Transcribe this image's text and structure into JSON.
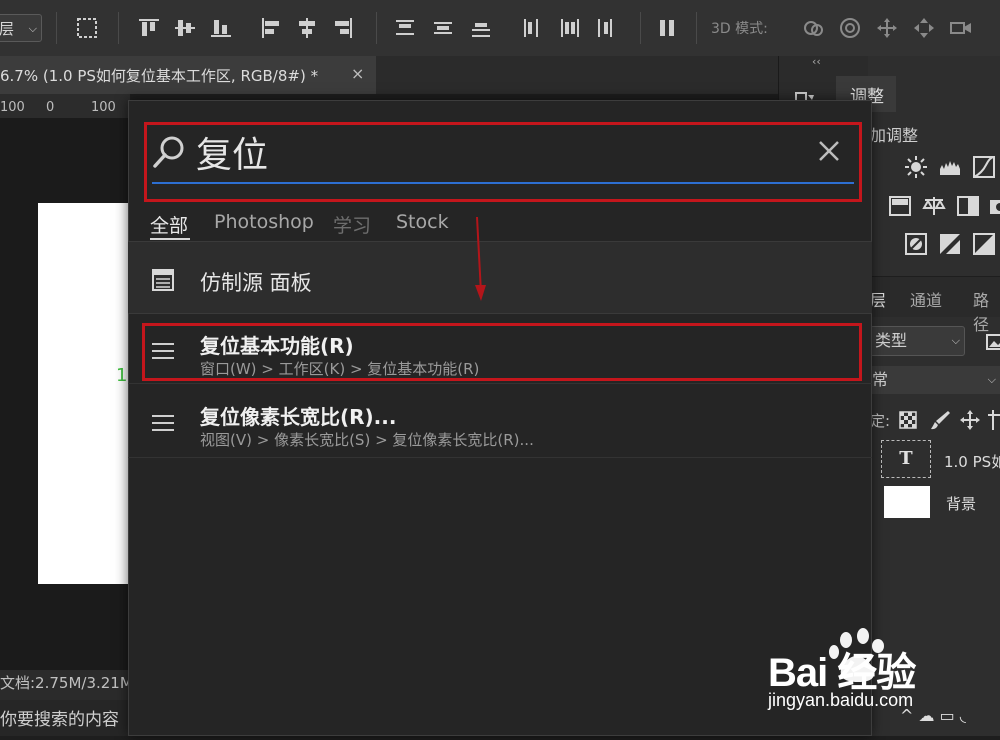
{
  "options_bar": {
    "layer_select": "层",
    "mode_label": "3D 模式:"
  },
  "document": {
    "tab_title": "6.7% (1.0 PS如何复位基本工作区, RGB/8#) *",
    "tab_close": "×",
    "ruler": [
      "100",
      "0",
      "100"
    ],
    "status": "文档:2.75M/3.21M",
    "bottom_text": "你要搜索的内容"
  },
  "right_panel": {
    "collapse": "‹‹",
    "adjust_tab": "调整",
    "add_adjust": "加调整",
    "tabs": [
      "层",
      "通道",
      "路径"
    ],
    "type_select": "类型",
    "blend_mode": "常",
    "lock_label": "定:",
    "layers": [
      {
        "thumb": "T",
        "name": "1.0 PS如"
      },
      {
        "thumb": "",
        "name": "背景"
      }
    ]
  },
  "search": {
    "query": "复位",
    "filters": [
      "全部",
      "Photoshop",
      "学习",
      "Stock"
    ],
    "active_filter": "全部",
    "results": [
      {
        "type": "panel",
        "label": "仿制源 面板"
      },
      {
        "type": "menu",
        "title": "复位基本功能(R)",
        "path": "窗口(W) > 工作区(K) > 复位基本功能(R)"
      },
      {
        "type": "menu",
        "title": "复位像素长宽比(R)...",
        "path": "视图(V) > 像素长宽比(S) > 复位像素长宽比(R)..."
      }
    ]
  },
  "watermark": {
    "logo": "Bai 经验",
    "url": "jingyan.baidu.com"
  },
  "colors": {
    "highlight": "#c4161c",
    "accent_blue": "#2d6fd2"
  }
}
